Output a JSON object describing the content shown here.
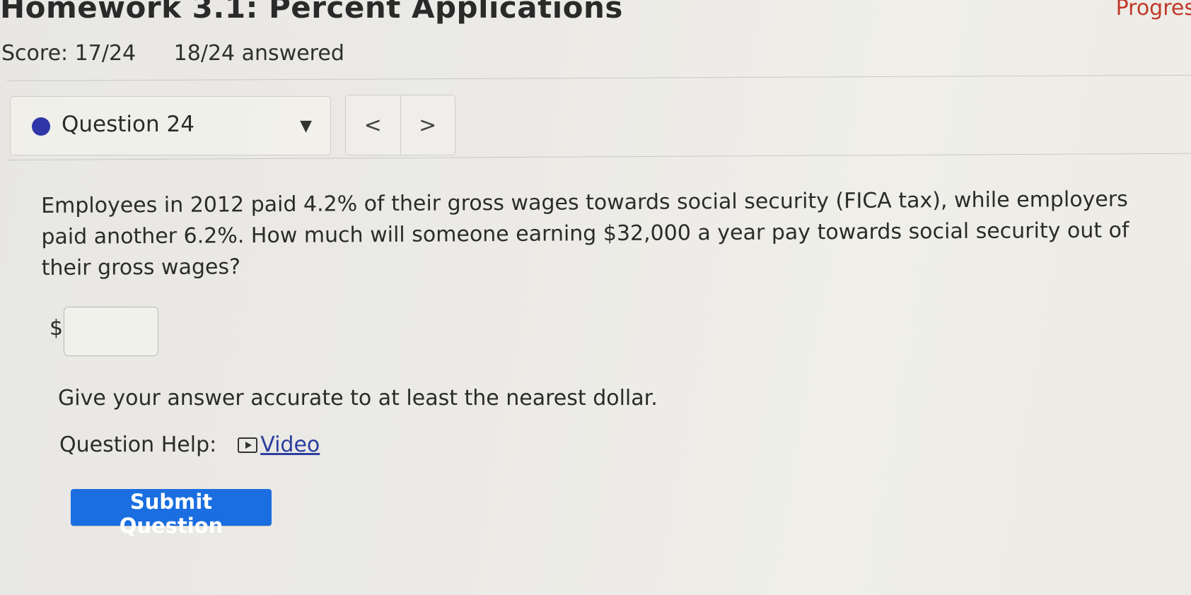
{
  "header": {
    "title": "Homework 3.1: Percent Applications",
    "progress_label": "Progres",
    "score": "Score: 17/24",
    "answered": "18/24 answered"
  },
  "question_nav": {
    "current_label": "Question 24",
    "dot_color": "#2e36a8",
    "caret_icon": "caret-down-icon",
    "prev_symbol": "<",
    "next_symbol": ">"
  },
  "question": {
    "text": "Employees in 2012 paid 4.2% of their gross wages towards social security (FICA tax), while employers paid another 6.2%. How much will someone earning $32,000 a year pay towards social security out of their gross wages?",
    "currency_symbol": "$",
    "answer_value": "",
    "hint": "Give your answer accurate to at least the nearest dollar."
  },
  "help": {
    "label": "Question Help:",
    "video_icon": "play-video-icon",
    "video_label": "Video"
  },
  "actions": {
    "submit_label": "Submit Question",
    "submit_color": "#1a6ee0"
  }
}
